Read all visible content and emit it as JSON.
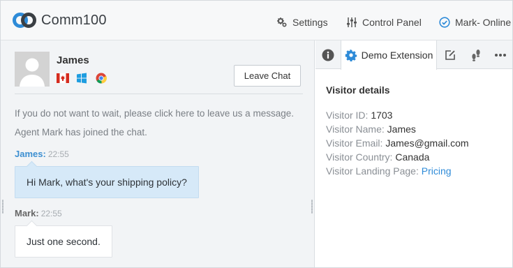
{
  "brand": {
    "name": "Comm100"
  },
  "nav": {
    "settings_label": "Settings",
    "control_panel_label": "Control Panel",
    "status_label": "Mark- Online"
  },
  "visitor": {
    "name": "James",
    "icons": [
      "canada-flag-icon",
      "windows-icon",
      "chrome-icon"
    ]
  },
  "chat": {
    "leave_chat_label": "Leave Chat",
    "system_messages": [
      "If you do not want to wait, please click here to leave us a message.",
      "Agent Mark has joined the chat."
    ],
    "messages": [
      {
        "sender": "James:",
        "time": "22:55",
        "text": "Hi Mark, what's your shipping policy?",
        "role": "visitor"
      },
      {
        "sender": "Mark:",
        "time": "22:55",
        "text": "Just one second.",
        "role": "agent"
      }
    ]
  },
  "side": {
    "active_tab_label": "Demo Extension",
    "tab_icons": [
      "info-icon",
      "gear-icon",
      "edit-icon",
      "footsteps-icon",
      "more-icon"
    ],
    "section_title": "Visitor details",
    "details": [
      {
        "key": "Visitor ID:",
        "value": "1703"
      },
      {
        "key": "Visitor Name:",
        "value": "James"
      },
      {
        "key": "Visitor Email:",
        "value": "James@gmail.com"
      },
      {
        "key": "Visitor Country:",
        "value": "Canada"
      },
      {
        "key": "Visitor Landing Page:",
        "value": "Pricing",
        "link": true
      }
    ]
  },
  "colors": {
    "accent": "#2e8bd8",
    "visitor_name": "#3d8fd1",
    "agent_name": "#666666",
    "visitor_bubble": "#d6e9f8",
    "link": "#2e8bd8"
  }
}
